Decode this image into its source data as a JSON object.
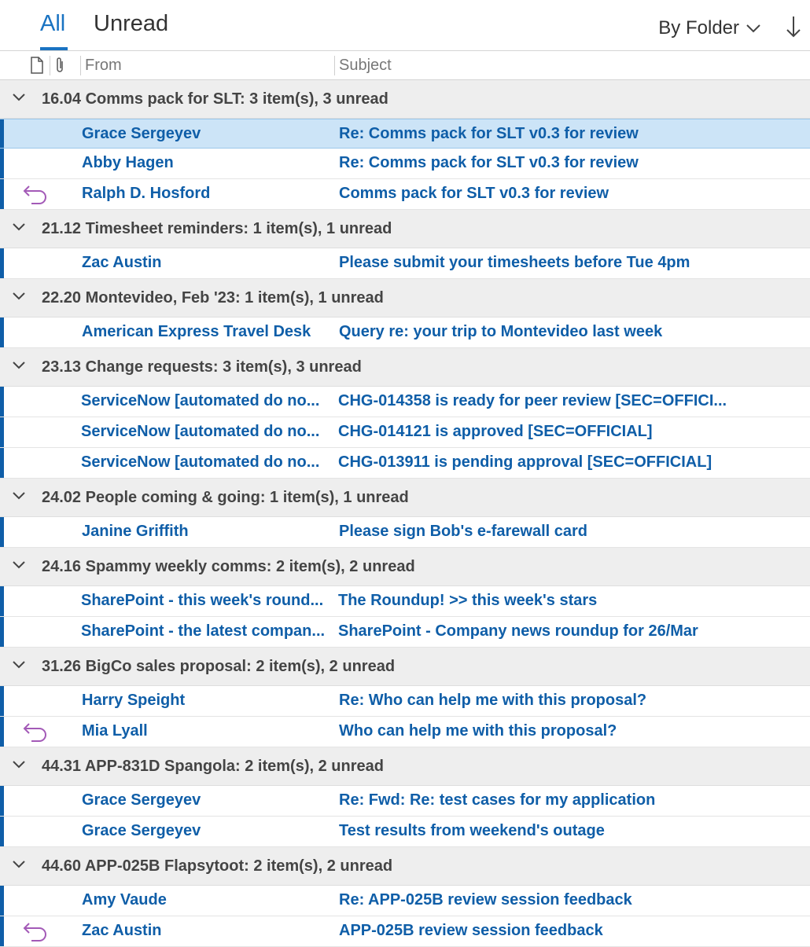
{
  "tabs": {
    "all": "All",
    "unread": "Unread"
  },
  "sort": {
    "label": "By Folder"
  },
  "columns": {
    "from": "From",
    "subject": "Subject"
  },
  "colors": {
    "accent": "#1a73c2",
    "unread_text": "#0f5ea8",
    "reply_icon": "#a35ab7",
    "selected_bg": "#cce4f7"
  },
  "groups": [
    {
      "label": "16.04 Comms pack for SLT: 3 item(s), 3 unread",
      "items": [
        {
          "from": "Grace Sergeyev",
          "subject": "Re: Comms pack for SLT v0.3 for review",
          "selected": true,
          "replied": false
        },
        {
          "from": "Abby Hagen",
          "subject": "Re: Comms pack for SLT v0.3 for review",
          "selected": false,
          "replied": false
        },
        {
          "from": "Ralph D. Hosford",
          "subject": "Comms pack for SLT v0.3 for review",
          "selected": false,
          "replied": true
        }
      ]
    },
    {
      "label": "21.12 Timesheet reminders: 1 item(s), 1 unread",
      "items": [
        {
          "from": "Zac Austin",
          "subject": "Please submit your timesheets before Tue 4pm",
          "selected": false,
          "replied": false
        }
      ]
    },
    {
      "label": "22.20 Montevideo, Feb '23: 1 item(s), 1 unread",
      "items": [
        {
          "from": "American Express Travel Desk",
          "subject": "Query re: your trip to Montevideo last week",
          "selected": false,
          "replied": false
        }
      ]
    },
    {
      "label": "23.13 Change requests: 3 item(s), 3 unread",
      "items": [
        {
          "from": "ServiceNow [automated do no...",
          "subject": "CHG-014358 is ready for peer review [SEC=OFFICI...",
          "selected": false,
          "replied": false
        },
        {
          "from": "ServiceNow [automated do no...",
          "subject": "CHG-014121 is approved [SEC=OFFICIAL]",
          "selected": false,
          "replied": false
        },
        {
          "from": "ServiceNow [automated do no...",
          "subject": "CHG-013911 is pending approval [SEC=OFFICIAL]",
          "selected": false,
          "replied": false
        }
      ]
    },
    {
      "label": "24.02 People coming & going: 1 item(s), 1 unread",
      "items": [
        {
          "from": "Janine Griffith",
          "subject": "Please sign Bob's e-farewall card",
          "selected": false,
          "replied": false
        }
      ]
    },
    {
      "label": "24.16 Spammy weekly comms: 2 item(s), 2 unread",
      "items": [
        {
          "from": "SharePoint - this week's round...",
          "subject": "The Roundup! >> this week's stars",
          "selected": false,
          "replied": false
        },
        {
          "from": "SharePoint - the latest compan...",
          "subject": "SharePoint - Company news roundup for 26/Mar",
          "selected": false,
          "replied": false
        }
      ]
    },
    {
      "label": "31.26 BigCo sales proposal: 2 item(s), 2 unread",
      "items": [
        {
          "from": "Harry Speight",
          "subject": "Re: Who can help me with this proposal?",
          "selected": false,
          "replied": false
        },
        {
          "from": "Mia Lyall",
          "subject": "Who can help me with this proposal?",
          "selected": false,
          "replied": true
        }
      ]
    },
    {
      "label": "44.31 APP-831D Spangola: 2 item(s), 2 unread",
      "items": [
        {
          "from": "Grace Sergeyev",
          "subject": "Re: Fwd: Re: test cases for my application",
          "selected": false,
          "replied": false
        },
        {
          "from": "Grace Sergeyev",
          "subject": "Test results from weekend's outage",
          "selected": false,
          "replied": false
        }
      ]
    },
    {
      "label": "44.60 APP-025B Flapsytoot: 2 item(s), 2 unread",
      "items": [
        {
          "from": "Amy Vaude",
          "subject": "Re: APP-025B review session feedback",
          "selected": false,
          "replied": false
        },
        {
          "from": "Zac Austin",
          "subject": "APP-025B review session feedback",
          "selected": false,
          "replied": true
        }
      ]
    }
  ]
}
